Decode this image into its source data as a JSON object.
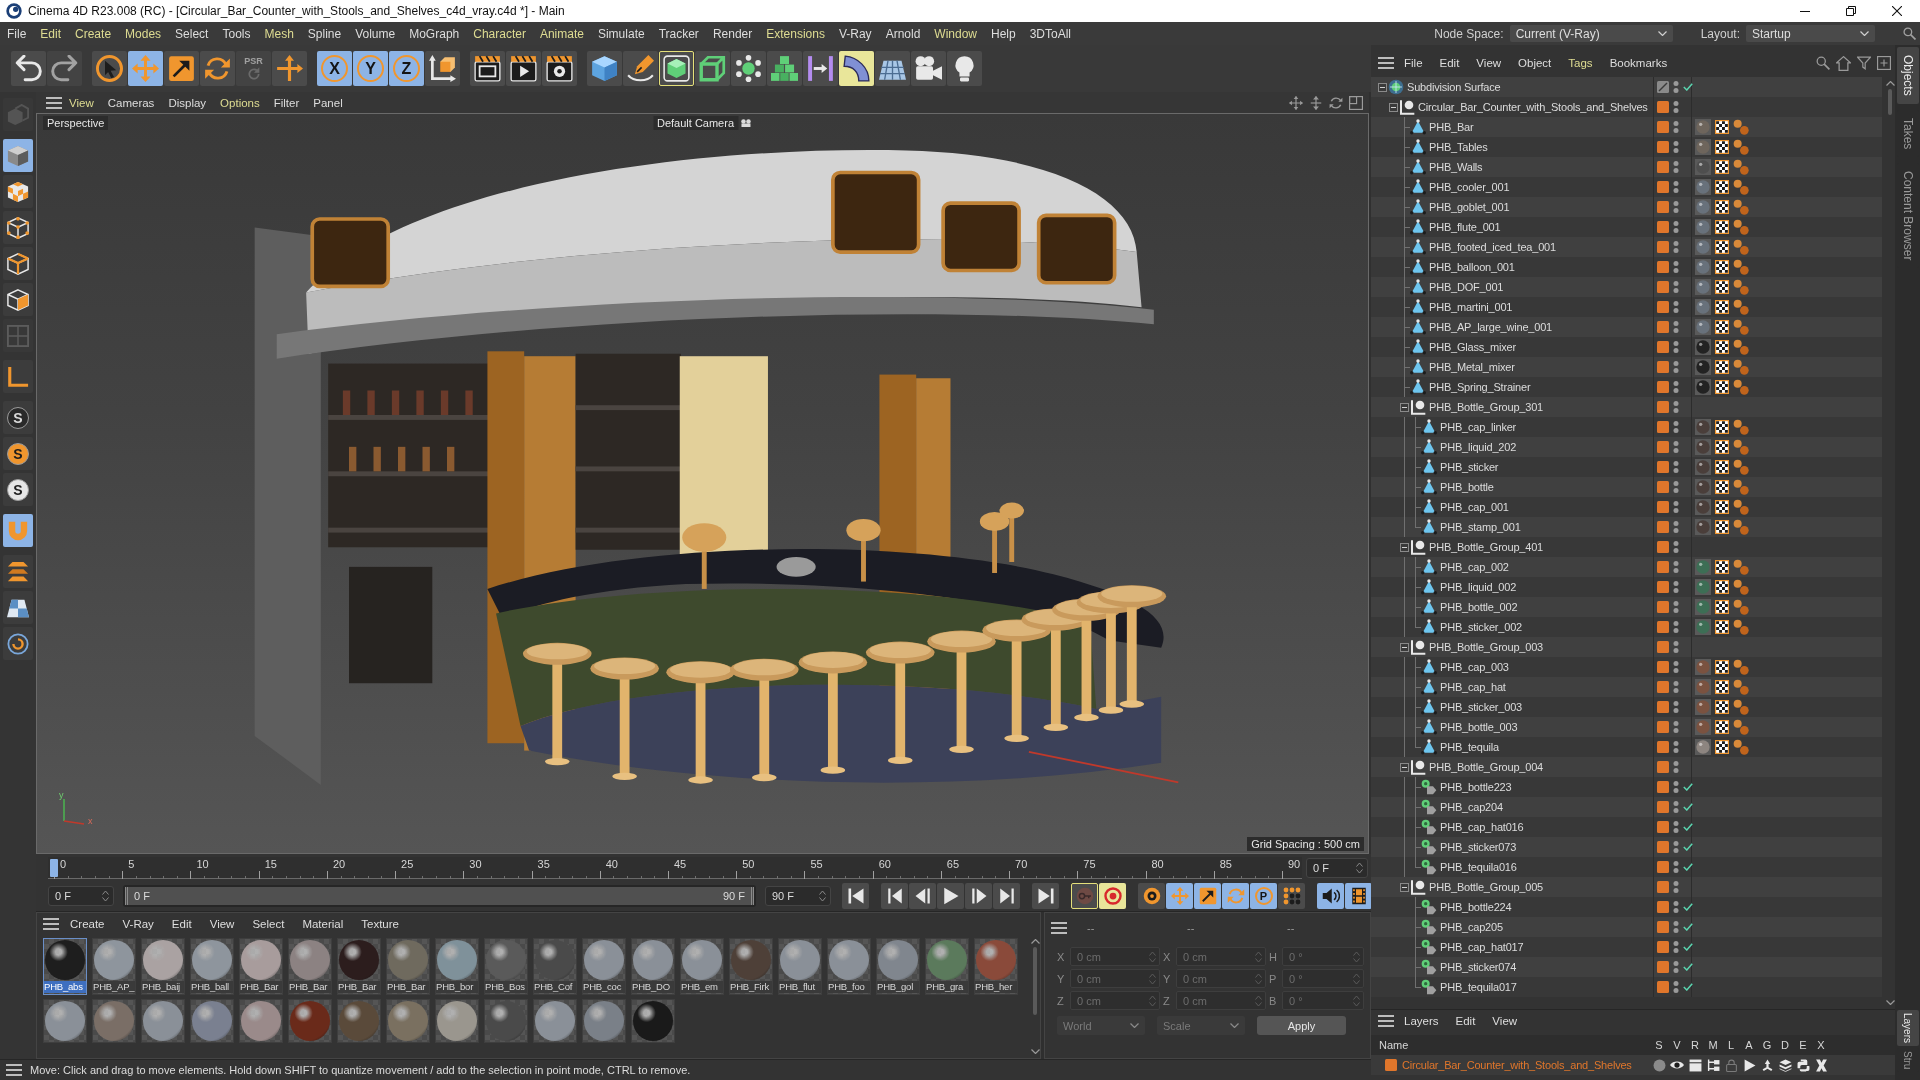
{
  "window": {
    "title": "Cinema 4D R23.008 (RC) - [Circular_Bar_Counter_with_Stools_and_Shelves_c4d_vray.c4d *] - Main"
  },
  "menu_bar": {
    "items": [
      {
        "label": "File",
        "highlighted": false
      },
      {
        "label": "Edit",
        "highlighted": true
      },
      {
        "label": "Create",
        "highlighted": true
      },
      {
        "label": "Modes",
        "highlighted": true
      },
      {
        "label": "Select",
        "highlighted": false
      },
      {
        "label": "Tools",
        "highlighted": false
      },
      {
        "label": "Mesh",
        "highlighted": true
      },
      {
        "label": "Spline",
        "highlighted": false
      },
      {
        "label": "Volume",
        "highlighted": false
      },
      {
        "label": "MoGraph",
        "highlighted": false
      },
      {
        "label": "Character",
        "highlighted": true
      },
      {
        "label": "Animate",
        "highlighted": true
      },
      {
        "label": "Simulate",
        "highlighted": false
      },
      {
        "label": "Tracker",
        "highlighted": false
      },
      {
        "label": "Render",
        "highlighted": false
      },
      {
        "label": "Extensions",
        "highlighted": true
      },
      {
        "label": "V-Ray",
        "highlighted": false
      },
      {
        "label": "Arnold",
        "highlighted": false
      },
      {
        "label": "Window",
        "highlighted": true
      },
      {
        "label": "Help",
        "highlighted": false
      },
      {
        "label": "3DToAll",
        "highlighted": false
      }
    ],
    "node_space": {
      "label": "Node Space:",
      "value": "Current (V-Ray)"
    },
    "layout": {
      "label": "Layout:",
      "value": "Startup"
    }
  },
  "toolbar": {
    "groups": [
      [
        {
          "kind": "undo",
          "active": false,
          "disabled": false,
          "highlighted": false,
          "outlined": false
        },
        {
          "kind": "redo",
          "active": false,
          "disabled": true,
          "highlighted": false,
          "outlined": false
        }
      ],
      [
        {
          "kind": "select",
          "active": false,
          "disabled": false,
          "highlighted": false,
          "outlined": false
        },
        {
          "kind": "move",
          "active": true,
          "disabled": false,
          "highlighted": false,
          "outlined": false
        },
        {
          "kind": "scale",
          "active": false,
          "disabled": false,
          "highlighted": false,
          "outlined": false
        },
        {
          "kind": "rotate",
          "active": false,
          "disabled": false,
          "highlighted": false,
          "outlined": false
        },
        {
          "kind": "psr",
          "label": "PSR",
          "active": false,
          "disabled": true,
          "highlighted": false,
          "outlined": false
        },
        {
          "kind": "axis",
          "active": false,
          "disabled": false,
          "highlighted": false,
          "outlined": false
        }
      ],
      [
        {
          "kind": "letter",
          "label": "X",
          "active": true,
          "disabled": false,
          "highlighted": false,
          "outlined": false
        },
        {
          "kind": "letter",
          "label": "Y",
          "active": true,
          "disabled": false,
          "highlighted": false,
          "outlined": false
        },
        {
          "kind": "letter",
          "label": "Z",
          "active": true,
          "disabled": false,
          "highlighted": false,
          "outlined": false
        },
        {
          "kind": "coordinates",
          "active": false,
          "disabled": false,
          "highlighted": false,
          "outlined": false
        }
      ],
      [
        {
          "kind": "region",
          "active": false,
          "disabled": false,
          "highlighted": false,
          "outlined": false
        },
        {
          "kind": "render",
          "active": false,
          "disabled": false,
          "highlighted": false,
          "outlined": false
        },
        {
          "kind": "settings",
          "active": false,
          "disabled": false,
          "highlighted": false,
          "outlined": false
        }
      ],
      [
        {
          "kind": "cube",
          "active": false,
          "disabled": false,
          "highlighted": false,
          "outlined": false
        },
        {
          "kind": "pen",
          "active": false,
          "disabled": false,
          "highlighted": false,
          "outlined": false
        },
        {
          "kind": "subdivision",
          "active": false,
          "disabled": false,
          "highlighted": false,
          "outlined": true
        },
        {
          "kind": "extrude",
          "active": false,
          "disabled": false,
          "highlighted": false,
          "outlined": false
        },
        {
          "kind": "cloner",
          "active": false,
          "disabled": false,
          "highlighted": false,
          "outlined": false
        },
        {
          "kind": "array",
          "active": false,
          "disabled": false,
          "highlighted": false,
          "outlined": false
        },
        {
          "kind": "symmetry",
          "active": false,
          "disabled": false,
          "highlighted": false,
          "outlined": false
        },
        {
          "kind": "bend",
          "active": false,
          "disabled": false,
          "highlighted": true,
          "outlined": false
        },
        {
          "kind": "floor",
          "active": false,
          "disabled": false,
          "highlighted": false,
          "outlined": false
        },
        {
          "kind": "camera",
          "active": false,
          "disabled": false,
          "highlighted": false,
          "outlined": false
        },
        {
          "kind": "light",
          "active": false,
          "disabled": false,
          "highlighted": false,
          "outlined": false
        }
      ]
    ]
  },
  "tool_strip": {
    "groups": [
      [
        {
          "kind": "editable",
          "active": false,
          "disabled": true
        }
      ],
      [
        {
          "kind": "model",
          "active": true,
          "disabled": false
        },
        {
          "kind": "texture",
          "active": false,
          "disabled": false
        },
        {
          "kind": "points",
          "active": false,
          "disabled": false
        },
        {
          "kind": "edges",
          "active": false,
          "disabled": false
        },
        {
          "kind": "polygons",
          "active": false,
          "disabled": false
        },
        {
          "kind": "uv",
          "active": false,
          "disabled": true
        }
      ],
      [
        {
          "kind": "corner",
          "active": false,
          "disabled": false
        }
      ],
      [
        {
          "kind": "solo",
          "label": "S",
          "active": false,
          "disabled": false
        },
        {
          "kind": "soloselect",
          "label": "S",
          "active": false,
          "disabled": false
        },
        {
          "kind": "solohierarchy",
          "label": "S",
          "active": false,
          "disabled": false
        }
      ],
      [
        {
          "kind": "snap",
          "active": true,
          "disabled": false
        }
      ],
      [
        {
          "kind": "workplane",
          "active": false,
          "disabled": false
        },
        {
          "kind": "grid",
          "active": false,
          "disabled": false
        },
        {
          "kind": "spiral",
          "active": false,
          "disabled": false
        }
      ]
    ]
  },
  "viewport": {
    "menu": [
      {
        "label": "View",
        "highlighted": true
      },
      {
        "label": "Cameras",
        "highlighted": false
      },
      {
        "label": "Display",
        "highlighted": false
      },
      {
        "label": "Options",
        "highlighted": true
      },
      {
        "label": "Filter",
        "highlighted": false
      },
      {
        "label": "Panel",
        "highlighted": false
      }
    ],
    "label": "Perspective",
    "camera": "Default Camera",
    "grid_spacing": "Grid Spacing : 500 cm",
    "axes": [
      "y",
      "x"
    ]
  },
  "timeline": {
    "ticks": [
      "0",
      "5",
      "10",
      "15",
      "20",
      "25",
      "30",
      "35",
      "40",
      "45",
      "50",
      "55",
      "60",
      "65",
      "70",
      "75",
      "80",
      "85",
      "90"
    ],
    "level": 0,
    "frame": "0 F"
  },
  "playback": {
    "start": "0 F",
    "range": {
      "start": "0 F",
      "end": "90 F",
      "level": 1
    },
    "end": "90 F",
    "groups": [
      [
        {
          "kind": "start",
          "active": false,
          "highlighted": false,
          "outlined": false
        }
      ],
      [
        {
          "kind": "prevkey",
          "active": false,
          "highlighted": false,
          "outlined": false
        },
        {
          "kind": "prevframe",
          "active": false,
          "highlighted": false,
          "outlined": false
        },
        {
          "kind": "play",
          "active": false,
          "highlighted": false,
          "outlined": false
        },
        {
          "kind": "nextframe",
          "active": false,
          "highlighted": false,
          "outlined": false
        },
        {
          "kind": "nextkey",
          "active": false,
          "highlighted": false,
          "outlined": false
        }
      ],
      [
        {
          "kind": "end",
          "active": false,
          "highlighted": false,
          "outlined": false
        }
      ],
      [
        {
          "kind": "autokey",
          "active": false,
          "highlighted": false,
          "outlined": true
        },
        {
          "kind": "record",
          "active": false,
          "highlighted": true,
          "outlined": false
        }
      ],
      [
        {
          "kind": "keysettings",
          "active": false,
          "highlighted": false,
          "outlined": false
        },
        {
          "kind": "keymove",
          "active": true,
          "highlighted": false,
          "outlined": false
        },
        {
          "kind": "keyscale",
          "active": true,
          "highlighted": false,
          "outlined": false
        },
        {
          "kind": "keyrotate",
          "active": true,
          "highlighted": false,
          "outlined": false
        },
        {
          "kind": "keyparam",
          "label": "P",
          "active": true,
          "highlighted": false,
          "outlined": false
        },
        {
          "kind": "keypla",
          "active": false,
          "highlighted": false,
          "outlined": false
        }
      ],
      [
        {
          "kind": "sound",
          "active": true,
          "highlighted": false,
          "outlined": false
        },
        {
          "kind": "film",
          "active": true,
          "highlighted": false,
          "outlined": false
        }
      ]
    ]
  },
  "material_manager": {
    "menu": [
      {
        "label": "Create"
      },
      {
        "label": "V-Ray"
      },
      {
        "label": "Edit"
      },
      {
        "label": "View"
      },
      {
        "label": "Select"
      },
      {
        "label": "Material"
      },
      {
        "label": "Texture"
      }
    ],
    "materials": [
      {
        "name": "PHB_abs",
        "color": "#1e1e1e",
        "selected": true
      },
      {
        "name": "PHB_AP_",
        "color": "#8e959d",
        "selected": false
      },
      {
        "name": "PHB_baij",
        "color": "#aaa2a2",
        "selected": false
      },
      {
        "name": "PHB_ball",
        "color": "#8e959d",
        "selected": false
      },
      {
        "name": "PHB_Bar",
        "color": "#a89c9c",
        "selected": false
      },
      {
        "name": "PHB_Bar",
        "color": "#8c8282",
        "selected": false
      },
      {
        "name": "PHB_Bar",
        "color": "#2c1d1d",
        "selected": false
      },
      {
        "name": "PHB_Bar",
        "color": "#6f6a5e",
        "selected": false
      },
      {
        "name": "PHB_bor",
        "color": "#7f919a",
        "selected": false
      },
      {
        "name": "PHB_Bos",
        "color": "#5a5a5a",
        "selected": false
      },
      {
        "name": "PHB_Cof",
        "color": "#4a4a4a",
        "selected": false
      },
      {
        "name": "PHB_coc",
        "color": "#8a9098",
        "selected": false
      },
      {
        "name": "PHB_DO",
        "color": "#8a9098",
        "selected": false
      },
      {
        "name": "PHB_em",
        "color": "#8a9098",
        "selected": false
      },
      {
        "name": "PHB_Firk",
        "color": "#4e4038",
        "selected": false
      },
      {
        "name": "PHB_flut",
        "color": "#8a9098",
        "selected": false
      },
      {
        "name": "PHB_foo",
        "color": "#8a9098",
        "selected": false
      },
      {
        "name": "PHB_gol",
        "color": "#80868e",
        "selected": false
      },
      {
        "name": "PHB_gra",
        "color": "#5b7a5c",
        "selected": false
      },
      {
        "name": "PHB_her",
        "color": "#8a4a3a",
        "selected": false
      },
      {
        "color": "#8a9098",
        "selected": false
      },
      {
        "color": "#7a6e66",
        "selected": false
      },
      {
        "color": "#8a9098",
        "selected": false
      },
      {
        "color": "#7a8090",
        "selected": false
      },
      {
        "color": "#9a8a8a",
        "selected": false
      },
      {
        "color": "#6a2a1a",
        "selected": false
      },
      {
        "color": "#5a4a3a",
        "selected": false
      },
      {
        "color": "#7a7060",
        "selected": false
      },
      {
        "color": "#9a968e",
        "selected": false
      },
      {
        "color": "#4a4a4a",
        "selected": false
      },
      {
        "color": "#8a9098",
        "selected": false
      },
      {
        "color": "#7a8088",
        "selected": false
      },
      {
        "color": "#1a1a1a",
        "selected": false
      }
    ]
  },
  "coordinates": {
    "headers": [
      "--",
      "--",
      "--"
    ],
    "disabled": true,
    "rows": [
      {
        "position_label": "X",
        "position": "0 cm",
        "size_label": "X",
        "size": "0 cm",
        "rotation_label": "H",
        "rotation": "0 °"
      },
      {
        "position_label": "Y",
        "position": "0 cm",
        "size_label": "Y",
        "size": "0 cm",
        "rotation_label": "P",
        "rotation": "0 °"
      },
      {
        "position_label": "Z",
        "position": "0 cm",
        "size_label": "Z",
        "size": "0 cm",
        "rotation_label": "B",
        "rotation": "0 °"
      }
    ],
    "mode": "World",
    "transform": "Scale",
    "apply": "Apply"
  },
  "status_bar": {
    "text": "Move: Click and drag to move elements. Hold down SHIFT to quantize movement / add to the selection in point mode, CTRL to remove."
  },
  "object_manager": {
    "menu": [
      {
        "label": "File",
        "highlighted": false
      },
      {
        "label": "Edit",
        "highlighted": false
      },
      {
        "label": "View",
        "highlighted": false
      },
      {
        "label": "Object",
        "highlighted": false
      },
      {
        "label": "Tags",
        "highlighted": true
      },
      {
        "label": "Bookmarks",
        "highlighted": false
      }
    ],
    "objects": [
      {
        "name": "Subdivision Surface",
        "kind": "subdivision",
        "layer": false,
        "check": true,
        "expanded": true,
        "children": [
          {
            "name": "Circular_Bar_Counter_with_Stools_and_Shelves",
            "kind": "null",
            "layer": true,
            "check": false,
            "expanded": true,
            "children": [
              {
                "name": "PHB_Bar",
                "kind": "polygon",
                "layer": true,
                "check": false,
                "tags": [
                  {
                    "kind": "material",
                    "color": "#6e655c"
                  },
                  {
                    "kind": "uvw"
                  },
                  {
                    "kind": "balls"
                  }
                ]
              },
              {
                "name": "PHB_Tables",
                "kind": "polygon",
                "layer": true,
                "check": false,
                "tags": [
                  {
                    "kind": "material",
                    "color": "#6e655c"
                  },
                  {
                    "kind": "uvw"
                  },
                  {
                    "kind": "balls"
                  }
                ]
              },
              {
                "name": "PHB_Walls",
                "kind": "polygon",
                "layer": true,
                "check": false,
                "tags": [
                  {
                    "kind": "material",
                    "color": "#4e4e4e"
                  },
                  {
                    "kind": "uvw"
                  },
                  {
                    "kind": "balls"
                  }
                ]
              },
              {
                "name": "PHB_cooler_001",
                "kind": "polygon",
                "layer": true,
                "check": false,
                "tags": [
                  {
                    "kind": "material",
                    "color": "#68717b"
                  },
                  {
                    "kind": "uvw"
                  },
                  {
                    "kind": "balls"
                  }
                ]
              },
              {
                "name": "PHB_goblet_001",
                "kind": "polygon",
                "layer": true,
                "check": false,
                "tags": [
                  {
                    "kind": "material",
                    "color": "#68717b"
                  },
                  {
                    "kind": "uvw"
                  },
                  {
                    "kind": "balls"
                  }
                ]
              },
              {
                "name": "PHB_flute_001",
                "kind": "polygon",
                "layer": true,
                "check": false,
                "tags": [
                  {
                    "kind": "material",
                    "color": "#68717b"
                  },
                  {
                    "kind": "uvw"
                  },
                  {
                    "kind": "balls"
                  }
                ]
              },
              {
                "name": "PHB_footed_iced_tea_001",
                "kind": "polygon",
                "layer": true,
                "check": false,
                "tags": [
                  {
                    "kind": "material",
                    "color": "#68717b"
                  },
                  {
                    "kind": "uvw"
                  },
                  {
                    "kind": "balls"
                  }
                ]
              },
              {
                "name": "PHB_balloon_001",
                "kind": "polygon",
                "layer": true,
                "check": false,
                "tags": [
                  {
                    "kind": "material",
                    "color": "#68717b"
                  },
                  {
                    "kind": "uvw"
                  },
                  {
                    "kind": "balls"
                  }
                ]
              },
              {
                "name": "PHB_DOF_001",
                "kind": "polygon",
                "layer": true,
                "check": false,
                "tags": [
                  {
                    "kind": "material",
                    "color": "#68717b"
                  },
                  {
                    "kind": "uvw"
                  },
                  {
                    "kind": "balls"
                  }
                ]
              },
              {
                "name": "PHB_martini_001",
                "kind": "polygon",
                "layer": true,
                "check": false,
                "tags": [
                  {
                    "kind": "material",
                    "color": "#68717b"
                  },
                  {
                    "kind": "uvw"
                  },
                  {
                    "kind": "balls"
                  }
                ]
              },
              {
                "name": "PHB_AP_large_wine_001",
                "kind": "polygon",
                "layer": true,
                "check": false,
                "tags": [
                  {
                    "kind": "material",
                    "color": "#68717b"
                  },
                  {
                    "kind": "uvw"
                  },
                  {
                    "kind": "balls"
                  }
                ]
              },
              {
                "name": "PHB_Glass_mixer",
                "kind": "polygon",
                "layer": true,
                "check": false,
                "tags": [
                  {
                    "kind": "material",
                    "color": "#222222"
                  },
                  {
                    "kind": "uvw"
                  },
                  {
                    "kind": "balls"
                  }
                ]
              },
              {
                "name": "PHB_Metal_mixer",
                "kind": "polygon",
                "layer": true,
                "check": false,
                "tags": [
                  {
                    "kind": "material",
                    "color": "#222222"
                  },
                  {
                    "kind": "uvw"
                  },
                  {
                    "kind": "balls"
                  }
                ]
              },
              {
                "name": "PHB_Spring_Strainer",
                "kind": "polygon",
                "layer": true,
                "check": false,
                "tags": [
                  {
                    "kind": "material",
                    "color": "#222222"
                  },
                  {
                    "kind": "uvw"
                  },
                  {
                    "kind": "balls"
                  }
                ]
              },
              {
                "name": "PHB_Bottle_Group_301",
                "kind": "null",
                "layer": true,
                "check": false,
                "expanded": true,
                "children": [
                  {
                    "name": "PHB_cap_linker",
                    "kind": "polygon",
                    "layer": true,
                    "check": false,
                    "tags": [
                      {
                        "kind": "material",
                        "color": "#4a3e3a"
                      },
                      {
                        "kind": "uvw"
                      },
                      {
                        "kind": "balls"
                      }
                    ]
                  },
                  {
                    "name": "PHB_liquid_202",
                    "kind": "polygon",
                    "layer": true,
                    "check": false,
                    "tags": [
                      {
                        "kind": "material",
                        "color": "#4a3e3a"
                      },
                      {
                        "kind": "uvw"
                      },
                      {
                        "kind": "balls"
                      }
                    ]
                  },
                  {
                    "name": "PHB_sticker",
                    "kind": "polygon",
                    "layer": true,
                    "check": false,
                    "tags": [
                      {
                        "kind": "material",
                        "color": "#4a3e3a"
                      },
                      {
                        "kind": "uvw"
                      },
                      {
                        "kind": "balls"
                      }
                    ]
                  },
                  {
                    "name": "PHB_bottle",
                    "kind": "polygon",
                    "layer": true,
                    "check": false,
                    "tags": [
                      {
                        "kind": "material",
                        "color": "#4a3e3a"
                      },
                      {
                        "kind": "uvw"
                      },
                      {
                        "kind": "balls"
                      }
                    ]
                  },
                  {
                    "name": "PHB_cap_001",
                    "kind": "polygon",
                    "layer": true,
                    "check": false,
                    "tags": [
                      {
                        "kind": "material",
                        "color": "#4a3e3a"
                      },
                      {
                        "kind": "uvw"
                      },
                      {
                        "kind": "balls"
                      }
                    ]
                  },
                  {
                    "name": "PHB_stamp_001",
                    "kind": "polygon",
                    "layer": true,
                    "check": false,
                    "tags": [
                      {
                        "kind": "material",
                        "color": "#4a3e3a"
                      },
                      {
                        "kind": "uvw"
                      },
                      {
                        "kind": "balls"
                      }
                    ]
                  }
                ]
              },
              {
                "name": "PHB_Bottle_Group_401",
                "kind": "null",
                "layer": true,
                "check": false,
                "expanded": true,
                "children": [
                  {
                    "name": "PHB_cap_002",
                    "kind": "polygon",
                    "layer": true,
                    "check": false,
                    "tags": [
                      {
                        "kind": "material",
                        "color": "#3d6e55"
                      },
                      {
                        "kind": "uvw"
                      },
                      {
                        "kind": "balls"
                      }
                    ]
                  },
                  {
                    "name": "PHB_liquid_002",
                    "kind": "polygon",
                    "layer": true,
                    "check": false,
                    "tags": [
                      {
                        "kind": "material",
                        "color": "#3d6e55"
                      },
                      {
                        "kind": "uvw"
                      },
                      {
                        "kind": "balls"
                      }
                    ]
                  },
                  {
                    "name": "PHB_bottle_002",
                    "kind": "polygon",
                    "layer": true,
                    "check": false,
                    "tags": [
                      {
                        "kind": "material",
                        "color": "#3d6e55"
                      },
                      {
                        "kind": "uvw"
                      },
                      {
                        "kind": "balls"
                      }
                    ]
                  },
                  {
                    "name": "PHB_sticker_002",
                    "kind": "polygon",
                    "layer": true,
                    "check": false,
                    "tags": [
                      {
                        "kind": "material",
                        "color": "#3d6e55"
                      },
                      {
                        "kind": "uvw"
                      },
                      {
                        "kind": "balls"
                      }
                    ]
                  }
                ]
              },
              {
                "name": "PHB_Bottle_Group_003",
                "kind": "null",
                "layer": true,
                "check": false,
                "expanded": true,
                "children": [
                  {
                    "name": "PHB_cap_003",
                    "kind": "polygon",
                    "layer": true,
                    "check": false,
                    "tags": [
                      {
                        "kind": "material",
                        "color": "#7a5240"
                      },
                      {
                        "kind": "uvw"
                      },
                      {
                        "kind": "balls"
                      }
                    ]
                  },
                  {
                    "name": "PHB_cap_hat",
                    "kind": "polygon",
                    "layer": true,
                    "check": false,
                    "tags": [
                      {
                        "kind": "material",
                        "color": "#7a5240"
                      },
                      {
                        "kind": "uvw"
                      },
                      {
                        "kind": "balls"
                      }
                    ]
                  },
                  {
                    "name": "PHB_sticker_003",
                    "kind": "polygon",
                    "layer": true,
                    "check": false,
                    "tags": [
                      {
                        "kind": "material",
                        "color": "#7a5240"
                      },
                      {
                        "kind": "uvw"
                      },
                      {
                        "kind": "balls"
                      }
                    ]
                  },
                  {
                    "name": "PHB_bottle_003",
                    "kind": "polygon",
                    "layer": true,
                    "check": false,
                    "tags": [
                      {
                        "kind": "material",
                        "color": "#7a5240"
                      },
                      {
                        "kind": "uvw"
                      },
                      {
                        "kind": "balls"
                      }
                    ]
                  },
                  {
                    "name": "PHB_tequila",
                    "kind": "polygon",
                    "layer": true,
                    "check": false,
                    "tags": [
                      {
                        "kind": "material",
                        "color": "#8d8580"
                      },
                      {
                        "kind": "uvw"
                      },
                      {
                        "kind": "balls"
                      }
                    ]
                  }
                ]
              },
              {
                "name": "PHB_Bottle_Group_004",
                "kind": "null",
                "layer": true,
                "check": false,
                "expanded": true,
                "children": [
                  {
                    "name": "PHB_bottle223",
                    "kind": "instance",
                    "layer": true,
                    "check": true
                  },
                  {
                    "name": "PHB_cap204",
                    "kind": "instance",
                    "layer": true,
                    "check": true
                  },
                  {
                    "name": "PHB_cap_hat016",
                    "kind": "instance",
                    "layer": true,
                    "check": true
                  },
                  {
                    "name": "PHB_sticker073",
                    "kind": "instance",
                    "layer": true,
                    "check": true
                  },
                  {
                    "name": "PHB_tequila016",
                    "kind": "instance",
                    "layer": true,
                    "check": true
                  }
                ]
              },
              {
                "name": "PHB_Bottle_Group_005",
                "kind": "null",
                "layer": true,
                "check": false,
                "expanded": true,
                "children": [
                  {
                    "name": "PHB_bottle224",
                    "kind": "instance",
                    "layer": true,
                    "check": true
                  },
                  {
                    "name": "PHB_cap205",
                    "kind": "instance",
                    "layer": true,
                    "check": true
                  },
                  {
                    "name": "PHB_cap_hat017",
                    "kind": "instance",
                    "layer": true,
                    "check": true
                  },
                  {
                    "name": "PHB_sticker074",
                    "kind": "instance",
                    "layer": true,
                    "check": true
                  },
                  {
                    "name": "PHB_tequila017",
                    "kind": "instance",
                    "layer": true,
                    "check": true
                  }
                ]
              }
            ]
          }
        ]
      }
    ]
  },
  "side_tabs": [
    {
      "label": "Objects",
      "selected": true
    },
    {
      "label": "Takes",
      "selected": false
    },
    {
      "label": "Content Browser",
      "selected": false
    }
  ],
  "layer_manager": {
    "menu": [
      {
        "label": "Layers"
      },
      {
        "label": "Edit"
      },
      {
        "label": "View"
      }
    ],
    "columns": [
      "Name",
      "S",
      "V",
      "R",
      "M",
      "L",
      "A",
      "G",
      "D",
      "E",
      "X"
    ],
    "layers": [
      {
        "name": "Circular_Bar_Counter_with_Stools_and_Shelves",
        "color": "#e0762b",
        "flags": [
          {
            "kind": "solo",
            "on": false
          },
          {
            "kind": "view",
            "on": true
          },
          {
            "kind": "render",
            "on": true
          },
          {
            "kind": "manager",
            "on": true
          },
          {
            "kind": "lock",
            "on": false
          },
          {
            "kind": "animation",
            "on": true
          },
          {
            "kind": "generators",
            "on": true
          },
          {
            "kind": "deformers",
            "on": true
          },
          {
            "kind": "expressions",
            "on": true
          },
          {
            "kind": "xref",
            "on": true
          }
        ]
      }
    ]
  },
  "layer_tabs": [
    {
      "label": "Layers",
      "selected": true
    },
    {
      "label": "Stru",
      "selected": false
    }
  ]
}
